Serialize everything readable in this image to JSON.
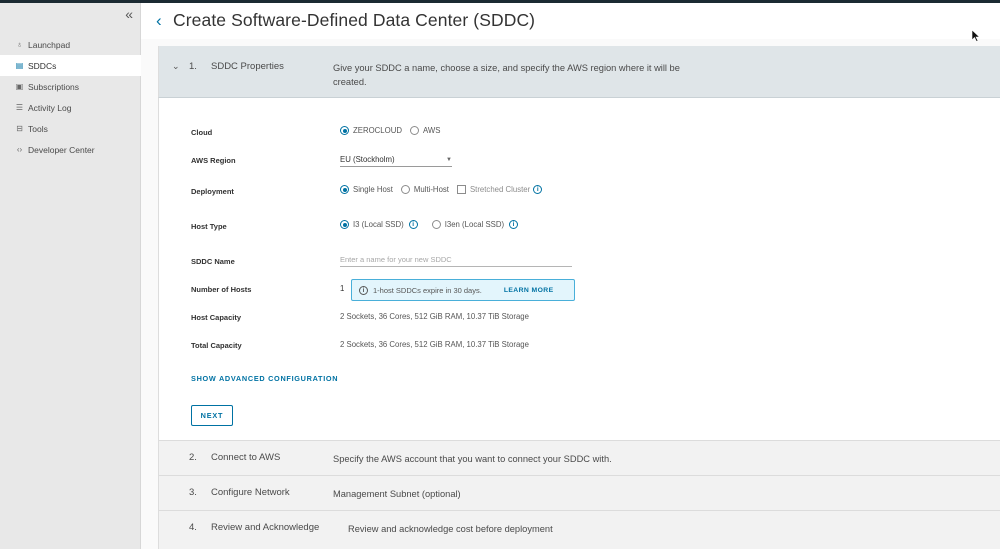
{
  "sidebar": {
    "collapse_icon": "double-chevron-left-icon",
    "items": [
      {
        "label": "Launchpad",
        "icon": "rocket-icon"
      },
      {
        "label": "SDDCs",
        "icon": "grid-icon"
      },
      {
        "label": "Subscriptions",
        "icon": "calendar-icon"
      },
      {
        "label": "Activity Log",
        "icon": "list-icon"
      },
      {
        "label": "Tools",
        "icon": "toolbox-icon"
      },
      {
        "label": "Developer Center",
        "icon": "code-icon"
      }
    ],
    "active": "SDDCs"
  },
  "header": {
    "back_icon": "chevron-left-icon",
    "title": "Create Software-Defined Data Center (SDDC)"
  },
  "steps": [
    {
      "num": "1.",
      "name": "SDDC Properties",
      "desc": "Give your SDDC a name, choose a size, and specify the AWS region where it will be",
      "desc2": "created."
    },
    {
      "num": "2.",
      "name": "Connect to AWS",
      "desc": "Specify the AWS account that you want to connect your SDDC with."
    },
    {
      "num": "3.",
      "name": "Configure Network",
      "desc": "Management Subnet (optional)"
    },
    {
      "num": "4.",
      "name": "Review and Acknowledge",
      "desc": "Review and acknowledge cost before deployment"
    }
  ],
  "form": {
    "cloud": {
      "label": "Cloud",
      "options": [
        "ZEROCLOUD",
        "AWS"
      ],
      "selected": "ZEROCLOUD"
    },
    "region": {
      "label": "AWS Region",
      "value": "EU (Stockholm)"
    },
    "deployment": {
      "label": "Deployment",
      "options": [
        "Single Host",
        "Multi-Host",
        "Stretched Cluster"
      ],
      "selected": "Single Host"
    },
    "host_type": {
      "label": "Host Type",
      "options": [
        "I3 (Local SSD)",
        "I3en (Local SSD)"
      ],
      "selected": "I3 (Local SSD)"
    },
    "sddc_name": {
      "label": "SDDC Name",
      "value": "",
      "placeholder": "Enter a name for your new SDDC"
    },
    "num_hosts": {
      "label": "Number of Hosts",
      "value": "1"
    },
    "alert": {
      "text": "1-host SDDCs expire in 30 days.",
      "link": "LEARN MORE"
    },
    "host_capacity": {
      "label": "Host Capacity",
      "value": "2 Sockets, 36 Cores, 512 GiB RAM, 10.37 TiB Storage"
    },
    "total_capacity": {
      "label": "Total Capacity",
      "value": "2 Sockets, 36 Cores, 512 GiB RAM, 10.37 TiB Storage"
    },
    "advanced_link": "SHOW ADVANCED CONFIGURATION",
    "next_label": "NEXT"
  },
  "colors": {
    "accent": "#0072a3",
    "step_header_bg": "#dfe5e8",
    "sidebar_bg": "#e8e8e8",
    "alert_bg": "#e3f5fc"
  }
}
